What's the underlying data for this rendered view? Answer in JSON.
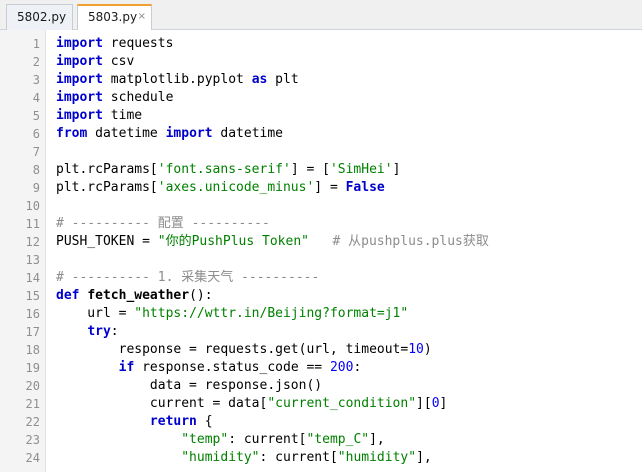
{
  "tabs": [
    {
      "label": "5802.py",
      "active": false
    },
    {
      "label": "5803.py",
      "active": true,
      "close": "×"
    }
  ],
  "code_lines": [
    {
      "n": "1",
      "tokens": [
        {
          "t": "import",
          "c": "kw"
        },
        {
          "t": " requests",
          "c": ""
        }
      ]
    },
    {
      "n": "2",
      "tokens": [
        {
          "t": "import",
          "c": "kw"
        },
        {
          "t": " csv",
          "c": ""
        }
      ]
    },
    {
      "n": "3",
      "tokens": [
        {
          "t": "import",
          "c": "kw"
        },
        {
          "t": " matplotlib.pyplot ",
          "c": ""
        },
        {
          "t": "as",
          "c": "kw"
        },
        {
          "t": " plt",
          "c": ""
        }
      ]
    },
    {
      "n": "4",
      "tokens": [
        {
          "t": "import",
          "c": "kw"
        },
        {
          "t": " schedule",
          "c": ""
        }
      ]
    },
    {
      "n": "5",
      "tokens": [
        {
          "t": "import",
          "c": "kw"
        },
        {
          "t": " time",
          "c": ""
        }
      ]
    },
    {
      "n": "6",
      "tokens": [
        {
          "t": "from",
          "c": "kw"
        },
        {
          "t": " datetime ",
          "c": ""
        },
        {
          "t": "import",
          "c": "kw"
        },
        {
          "t": " datetime",
          "c": ""
        }
      ]
    },
    {
      "n": "7",
      "tokens": []
    },
    {
      "n": "8",
      "tokens": [
        {
          "t": "plt.rcParams[",
          "c": ""
        },
        {
          "t": "'font.sans-serif'",
          "c": "str"
        },
        {
          "t": "] = [",
          "c": ""
        },
        {
          "t": "'SimHei'",
          "c": "str"
        },
        {
          "t": "]",
          "c": ""
        }
      ]
    },
    {
      "n": "9",
      "tokens": [
        {
          "t": "plt.rcParams[",
          "c": ""
        },
        {
          "t": "'axes.unicode_minus'",
          "c": "str"
        },
        {
          "t": "] = ",
          "c": ""
        },
        {
          "t": "False",
          "c": "kw"
        }
      ]
    },
    {
      "n": "10",
      "tokens": []
    },
    {
      "n": "11",
      "tokens": [
        {
          "t": "# ---------- 配置 ----------",
          "c": "cmt"
        }
      ]
    },
    {
      "n": "12",
      "tokens": [
        {
          "t": "PUSH_TOKEN = ",
          "c": ""
        },
        {
          "t": "\"你的PushPlus Token\"",
          "c": "str"
        },
        {
          "t": "   ",
          "c": ""
        },
        {
          "t": "# 从pushplus.plus获取",
          "c": "cmt"
        }
      ]
    },
    {
      "n": "13",
      "tokens": []
    },
    {
      "n": "14",
      "tokens": [
        {
          "t": "# ---------- 1. 采集天气 ----------",
          "c": "cmt"
        }
      ]
    },
    {
      "n": "15",
      "tokens": [
        {
          "t": "def",
          "c": "kw"
        },
        {
          "t": " ",
          "c": ""
        },
        {
          "t": "fetch_weather",
          "c": "fn"
        },
        {
          "t": "():",
          "c": ""
        }
      ]
    },
    {
      "n": "16",
      "tokens": [
        {
          "t": "    url = ",
          "c": ""
        },
        {
          "t": "\"https://wttr.in/Beijing?format=j1\"",
          "c": "str"
        }
      ]
    },
    {
      "n": "17",
      "tokens": [
        {
          "t": "    ",
          "c": ""
        },
        {
          "t": "try",
          "c": "kw"
        },
        {
          "t": ":",
          "c": ""
        }
      ]
    },
    {
      "n": "18",
      "tokens": [
        {
          "t": "        response = requests.get(url, timeout=",
          "c": ""
        },
        {
          "t": "10",
          "c": "num"
        },
        {
          "t": ")",
          "c": ""
        }
      ]
    },
    {
      "n": "19",
      "tokens": [
        {
          "t": "        ",
          "c": ""
        },
        {
          "t": "if",
          "c": "kw"
        },
        {
          "t": " response.status_code == ",
          "c": ""
        },
        {
          "t": "200",
          "c": "num"
        },
        {
          "t": ":",
          "c": ""
        }
      ]
    },
    {
      "n": "20",
      "tokens": [
        {
          "t": "            data = response.json()",
          "c": ""
        }
      ]
    },
    {
      "n": "21",
      "tokens": [
        {
          "t": "            current = data[",
          "c": ""
        },
        {
          "t": "\"current_condition\"",
          "c": "str"
        },
        {
          "t": "][",
          "c": ""
        },
        {
          "t": "0",
          "c": "num"
        },
        {
          "t": "]",
          "c": ""
        }
      ]
    },
    {
      "n": "22",
      "tokens": [
        {
          "t": "            ",
          "c": ""
        },
        {
          "t": "return",
          "c": "kw"
        },
        {
          "t": " {",
          "c": ""
        }
      ]
    },
    {
      "n": "23",
      "tokens": [
        {
          "t": "                ",
          "c": ""
        },
        {
          "t": "\"temp\"",
          "c": "str"
        },
        {
          "t": ": current[",
          "c": ""
        },
        {
          "t": "\"temp_C\"",
          "c": "str"
        },
        {
          "t": "],",
          "c": ""
        }
      ]
    },
    {
      "n": "24",
      "tokens": [
        {
          "t": "                ",
          "c": ""
        },
        {
          "t": "\"humidity\"",
          "c": "str"
        },
        {
          "t": ": current[",
          "c": ""
        },
        {
          "t": "\"humidity\"",
          "c": "str"
        },
        {
          "t": "],",
          "c": ""
        }
      ]
    }
  ]
}
